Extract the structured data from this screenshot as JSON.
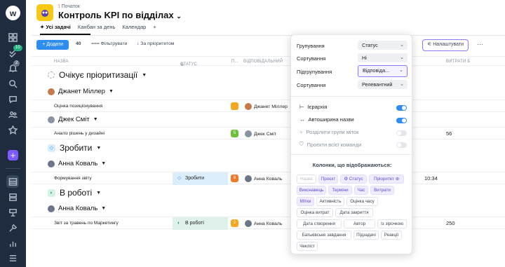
{
  "rail": {
    "badges": [
      "10",
      "2"
    ]
  },
  "header": {
    "breadcrumb": "Початок",
    "title": "Контроль KPI по відділах"
  },
  "tabs": [
    "Усі задачі",
    "Канбан за день",
    "Календар",
    "+"
  ],
  "toolbar": {
    "add": "+ Додати",
    "count": "40",
    "filters": "Фільтрувати",
    "sort": "За пріоритетом",
    "settings": "Налаштувати",
    "more": "···"
  },
  "columns": [
    "НАЗВА",
    "СТАТУС",
    "П...",
    "ВІДПОВІДАЛЬНИЙ",
    "ВИТРАТИ Б"
  ],
  "groups": [
    {
      "title": "Очікує пріоритизації"
    },
    {
      "title": "Зробити"
    },
    {
      "title": "В роботі"
    }
  ],
  "people": [
    "Джанет Міллер",
    "Джек Сміт",
    "Анна Коваль",
    "Анна Коваль"
  ],
  "rows": [
    {
      "name": "Оцінка позиціонування",
      "status": "",
      "prio": "",
      "resp": "Джанет Міллер",
      "extra": ""
    },
    {
      "name": "Аналіз рішень у дизайні",
      "status": "",
      "prio": "5",
      "resp": "Джек Сміт",
      "extra": "56"
    },
    {
      "name": "Формування звіту",
      "status": "Зробити",
      "prio": "8",
      "resp": "Анна Коваль",
      "extra": "10:34"
    },
    {
      "name": "Звіт за травень по Маркетингу",
      "status": "В роботі",
      "prio": "2",
      "resp": "Анна Коваль",
      "extra": "250"
    }
  ],
  "popup": {
    "labels": [
      "Групування",
      "Сортування",
      "Підгрупування",
      "Сортування"
    ],
    "values": [
      "Статус",
      "Ні",
      "Відповіда...",
      "Релевантний"
    ],
    "toggles": [
      {
        "label": "Ієрархія",
        "on": true
      },
      {
        "label": "Автоширина назви",
        "on": true
      },
      {
        "label": "Розділити групи міток",
        "on": false
      },
      {
        "label": "Проєкти всієї команди",
        "on": false
      }
    ],
    "columns_title": "Колонки, що відображаються:",
    "chips": [
      "Назва",
      "Проєкт",
      "Статус",
      "Пріоритет",
      "Виконавець",
      "Терміни",
      "Час",
      "Витрати",
      "Мітки",
      "Активність",
      "Оцінка часу",
      "Оцінка витрат",
      "Дата закриття",
      "Дата створення",
      "Автор",
      "Із зірочкою",
      "Батьківське завдання",
      "Підзадачі",
      "Реакції",
      "Чекліст"
    ]
  },
  "colors": {
    "accent": "#2f8df0",
    "highlight": "#8b7cff",
    "rail": "#1f2c3f"
  }
}
